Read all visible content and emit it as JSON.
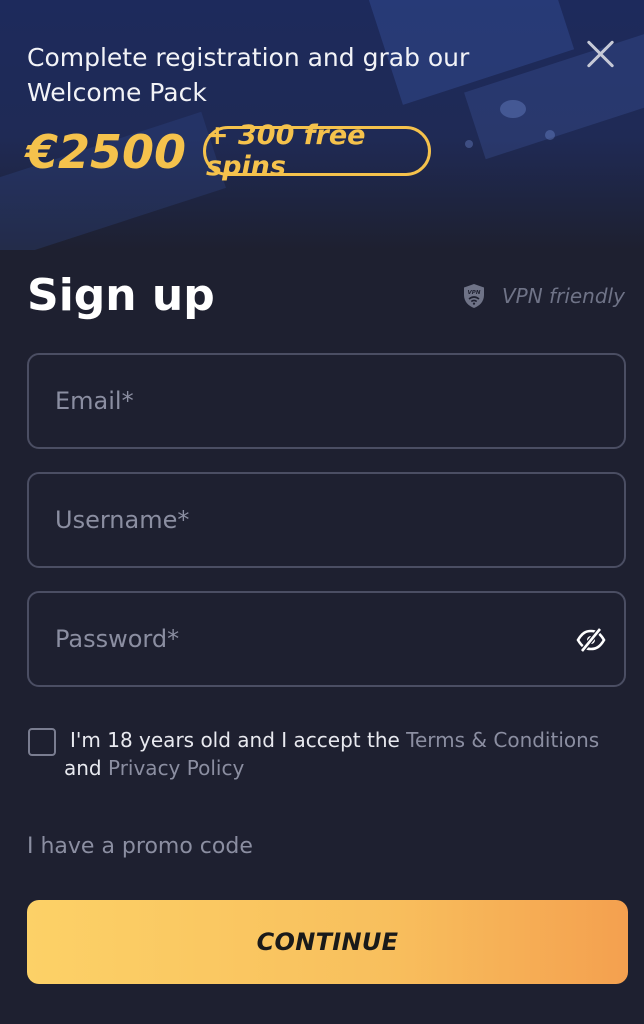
{
  "promo": {
    "headline": "Complete registration and grab our Welcome Pack",
    "amount": "€2500",
    "spins": "+ 300 free spins"
  },
  "signup": {
    "title": "Sign up",
    "vpn_label": "VPN friendly",
    "vpn_badge_text": "VPN"
  },
  "form": {
    "email_placeholder": "Email*",
    "username_placeholder": "Username*",
    "password_placeholder": "Password*",
    "email_value": "",
    "username_value": "",
    "password_value": ""
  },
  "consent": {
    "prefix": "I'm 18 years old and I accept the ",
    "terms_link": "Terms & Conditions",
    "joiner": " and ",
    "privacy_link": "Privacy Policy",
    "checked": false
  },
  "promo_code_link": "I have a promo code",
  "continue_label": "CONTINUE",
  "icons": {
    "close": "close-icon",
    "vpn": "shield-icon",
    "password_toggle": "eye-slash-icon",
    "checkbox": "checkbox-icon"
  },
  "colors": {
    "background": "#1e2030",
    "accent": "#f5c24c",
    "button_start": "#fcd167",
    "button_end": "#f4a04f",
    "muted_text": "#8b8ea1",
    "field_border": "#4b4e63"
  }
}
